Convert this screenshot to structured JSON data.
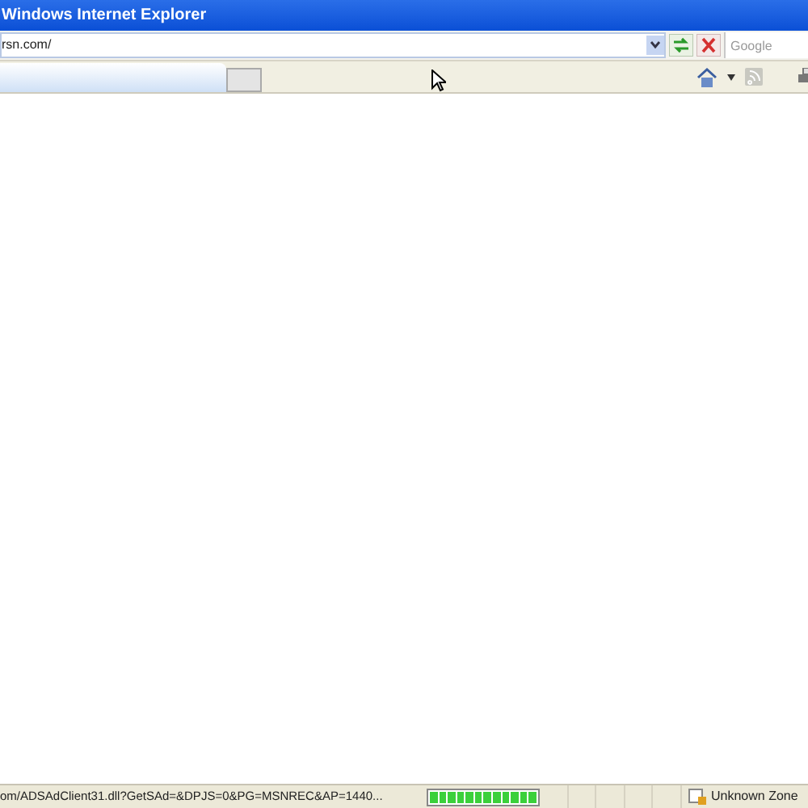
{
  "window": {
    "title": "Windows Internet Explorer"
  },
  "address_bar": {
    "value": "rsn.com/"
  },
  "search": {
    "placeholder": "Google"
  },
  "status_bar": {
    "text": "om/ADSAdClient31.dll?GetSAd=&DPJS=0&PG=MSNREC&AP=1440...",
    "progress": {
      "level": 1
    },
    "zone": "Unknown Zone"
  }
}
